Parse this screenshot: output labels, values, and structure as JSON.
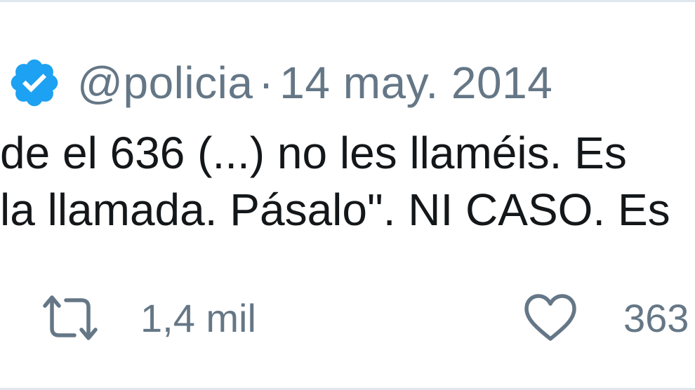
{
  "tweet": {
    "handle": "@policia",
    "separator": "·",
    "date": "14 may. 2014",
    "text_lines": [
      "de el 636 (...) no les llaméis. Es",
      "la llamada. Pásalo\". NI CASO. Es"
    ],
    "retweets": "1,4 mil",
    "likes": "363"
  },
  "colors": {
    "verified": "#1da1f2",
    "meta_text": "#657786",
    "body_text": "#14171a",
    "border": "#e1e8ed"
  },
  "icons": {
    "verified": "verified-badge-icon",
    "retweet": "retweet-icon",
    "like": "heart-icon"
  }
}
